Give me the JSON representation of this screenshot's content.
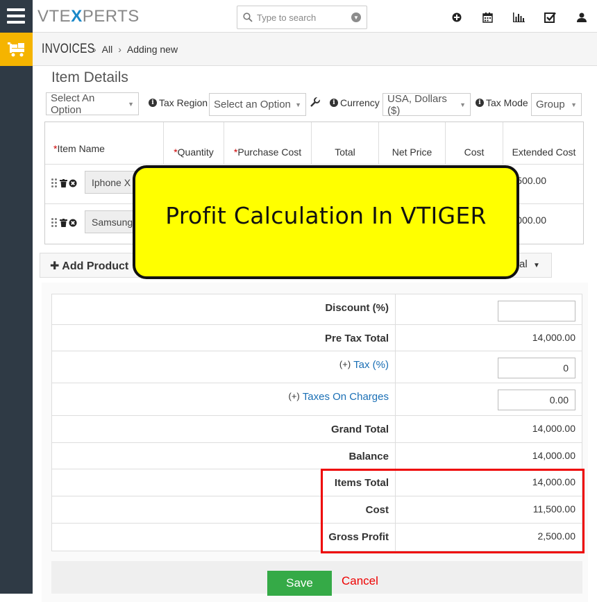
{
  "app": {
    "logo_prefix": "VTE",
    "logo_x": "X",
    "logo_suffix": "PERTS"
  },
  "search": {
    "placeholder": "Type to search"
  },
  "topbar_icons": [
    "plus-circle-icon",
    "calendar-icon",
    "chart-icon",
    "tasks-check-icon",
    "user-icon"
  ],
  "breadcrumb": {
    "module": "INVOICES",
    "items": [
      "All",
      "Adding new"
    ]
  },
  "item_details": {
    "title": "Item Details",
    "select_option": "Select An Option",
    "tax_region_label": "Tax Region",
    "tax_region_value": "Select an Option",
    "currency_label": "Currency",
    "currency_value": "USA, Dollars ($)",
    "tax_mode_label": "Tax Mode",
    "tax_mode_value": "Group"
  },
  "table": {
    "columns": [
      "Item Name",
      "Quantity",
      "Purchase Cost",
      "Total",
      "Net Price",
      "Cost",
      "Extended Cost"
    ],
    "required_marker": "*",
    "rows": [
      {
        "product": "Iphone X",
        "extended_cost": "500.00"
      },
      {
        "product": "Samsung",
        "extended_cost": "000.00"
      }
    ]
  },
  "add_product_label": "Add Product",
  "total_select_partial": "al",
  "totals": {
    "discount_label": "Discount (%)",
    "discount_value": "",
    "pre_tax_total_label": "Pre Tax Total",
    "pre_tax_total_value": "14,000.00",
    "tax_plus": "(+)",
    "tax_label": "Tax (%)",
    "tax_value": "0",
    "charges_plus": "(+)",
    "charges_label": "Taxes On Charges",
    "charges_value": "0.00",
    "grand_total_label": "Grand Total",
    "grand_total_value": "14,000.00",
    "balance_label": "Balance",
    "balance_value": "14,000.00",
    "items_total_label": "Items Total",
    "items_total_value": "14,000.00",
    "cost_label": "Cost",
    "cost_value": "11,500.00",
    "gross_profit_label": "Gross Profit",
    "gross_profit_value": "2,500.00"
  },
  "actions": {
    "save": "Save",
    "cancel": "Cancel"
  },
  "overlay": {
    "text": "Profit Calculation In VTIGER"
  },
  "colors": {
    "rail": "#2f3a45",
    "module_accent": "#f5b400",
    "brand_blue": "#1a88c9",
    "highlight_red": "#e00000",
    "banner_yellow": "#ffff00",
    "save_green": "#35aa47"
  }
}
